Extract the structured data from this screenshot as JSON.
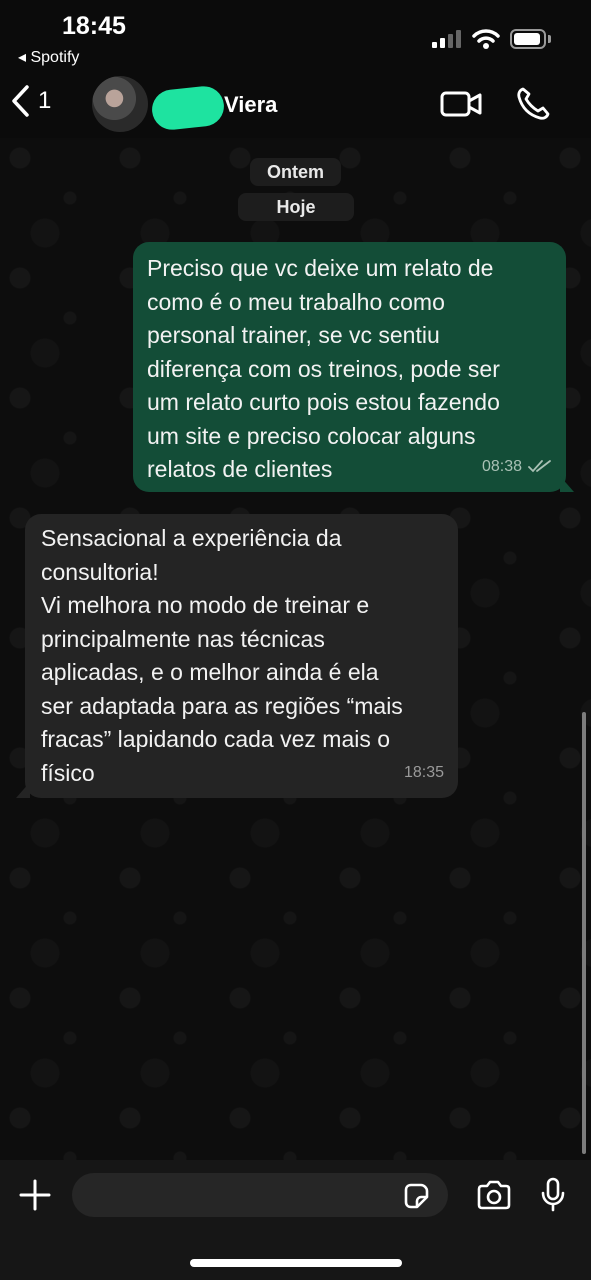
{
  "status_bar": {
    "time": "18:45",
    "back_app": "◂ Spotify"
  },
  "header": {
    "back_count": "1",
    "contact_name": "Viera"
  },
  "date_chips": [
    "Ontem",
    "Hoje"
  ],
  "messages": [
    {
      "direction": "outgoing",
      "text": "Preciso que vc deixe um relato de\ncomo é o meu trabalho como\npersonal trainer, se vc sentiu\ndiferença com os treinos, pode ser\num relato curto pois estou fazendo\num site e preciso colocar alguns\nrelatos de clientes",
      "time": "08:38",
      "status": "read"
    },
    {
      "direction": "incoming",
      "text": "Sensacional a experiência da\nconsultoria!\nVi melhora no modo de treinar e\nprincipalmente nas técnicas\naplicadas, e o melhor ainda é ela\nser adaptada para as regiões “mais\nfracas” lapidando cada vez mais o\nfísico",
      "time": "18:35"
    }
  ],
  "composer": {
    "value": ""
  },
  "colors": {
    "outgoing_bubble": "#134d37",
    "incoming_bubble": "#242424",
    "highlight_scribble": "#1ee3a0"
  }
}
